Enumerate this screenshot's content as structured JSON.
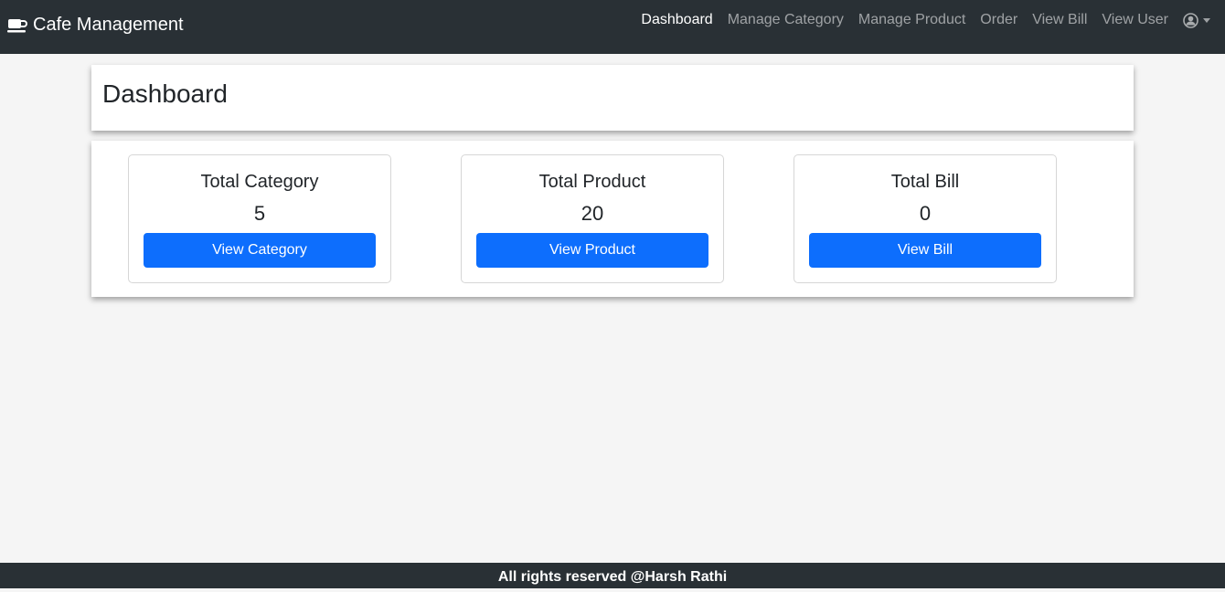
{
  "navbar": {
    "brand": "Cafe Management",
    "links": [
      "Dashboard",
      "Manage Category",
      "Manage Product",
      "Order",
      "View Bill",
      "View User"
    ]
  },
  "page": {
    "title": "Dashboard"
  },
  "stats": [
    {
      "title": "Total Category",
      "value": "5",
      "button": "View Category"
    },
    {
      "title": "Total Product",
      "value": "20",
      "button": "View Product"
    },
    {
      "title": "Total Bill",
      "value": "0",
      "button": "View Bill"
    }
  ],
  "footer": {
    "text": "All rights reserved @Harsh Rathi"
  },
  "colors": {
    "navbar": "#293035",
    "primary": "#0d6efd",
    "background": "#f5f5f5"
  }
}
